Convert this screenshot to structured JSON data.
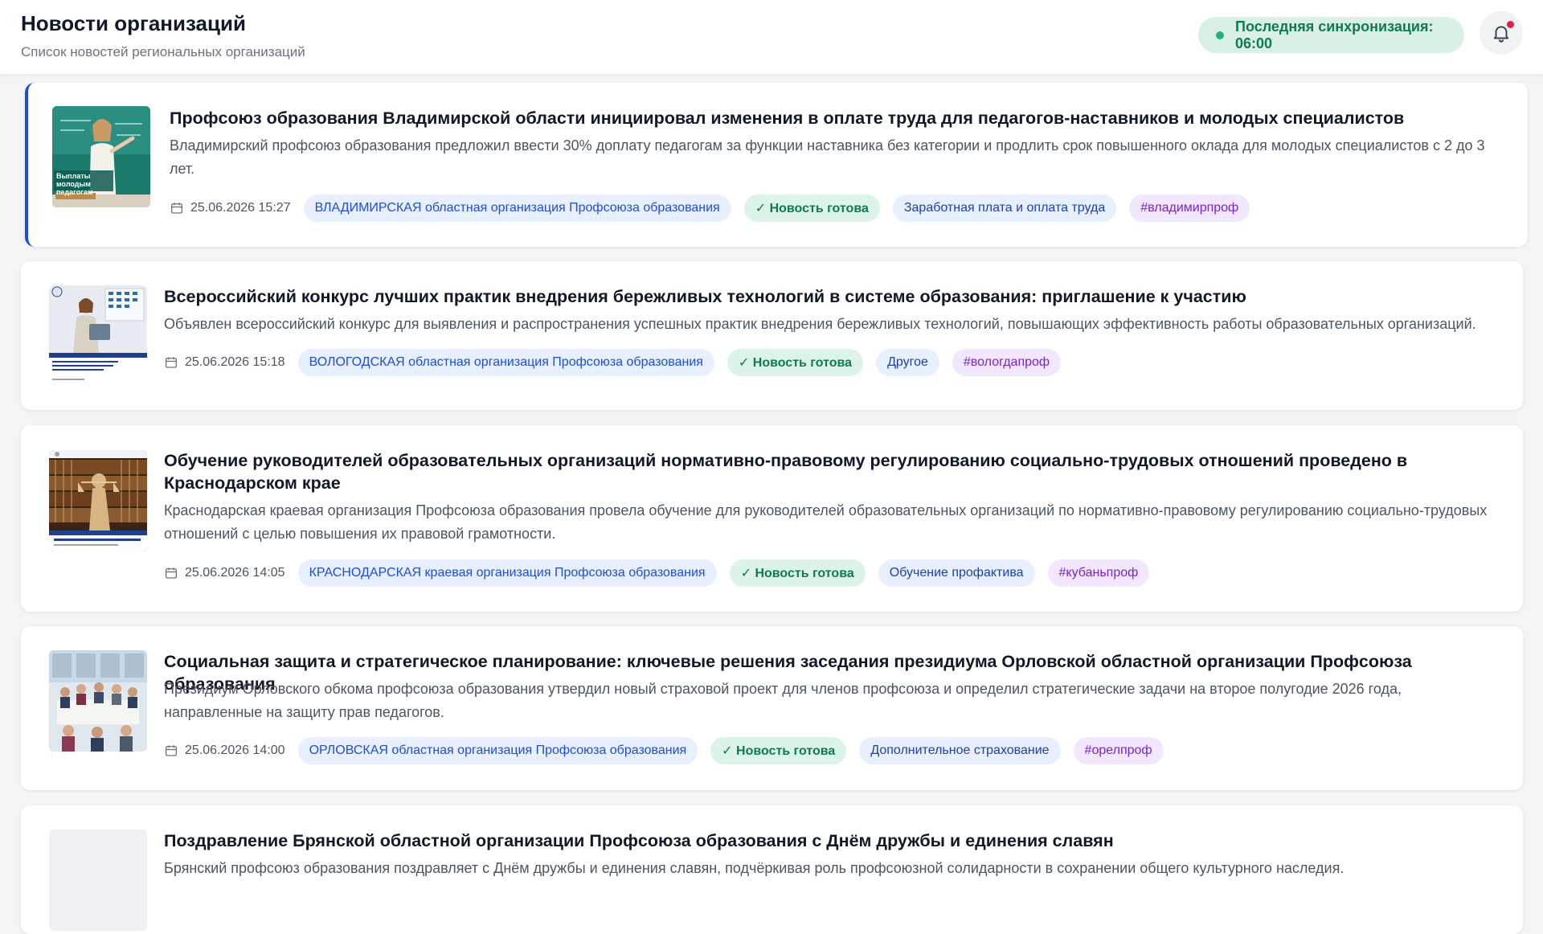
{
  "header": {
    "title": "Новости организаций",
    "subtitle": "Список новостей региональных организаций",
    "sync_label": "Последняя синхронизация: 06:00",
    "bell_icon": "bell-icon",
    "has_notification": true
  },
  "colors": {
    "accent": "#1d4ed8",
    "ready_green": "#0f7a53",
    "hashtag_purple": "#7e22ce",
    "notification_red": "#e11d48"
  },
  "news": [
    {
      "title": "Профсоюз образования Владимирской области инициировал изменения в оплате труда для педагогов-наставников и молодых специалистов",
      "description": "Владимирский профсоюз образования предложил ввести 30% доплату педагогам за функции наставника без категории и продлить срок повышенного оклада для молодых специалистов с 2 до 3 лет.",
      "date": "25.06.2026 15:27",
      "organization": "ВЛАДИМИРСКАЯ областная организация Профсоюза образования",
      "status": "✓ Новость готова",
      "category": "Заработная плата и оплата труда",
      "hashtag": "#владимирпроф",
      "thumb_caption": "Выплаты молодым педагогам"
    },
    {
      "title": "Всероссийский конкурс лучших практик внедрения бережливых технологий в системе образования: приглашение к участию",
      "description": "Объявлен всероссийский конкурс для выявления и распространения успешных практик внедрения бережливых технологий, повышающих эффективность работы образовательных организаций.",
      "date": "25.06.2026 15:18",
      "organization": "ВОЛОГОДСКАЯ областная организация Профсоюза образования",
      "status": "✓ Новость готова",
      "category": "Другое",
      "hashtag": "#вологдапроф"
    },
    {
      "title": "Обучение руководителей образовательных организаций нормативно-правовому регулированию социально-трудовых отношений проведено в Краснодарском крае",
      "description": "Краснодарская краевая организация Профсоюза образования провела обучение для руководителей образовательных организаций по нормативно-правовому регулированию социально-трудовых отношений с целью повышения их правовой грамотности.",
      "date": "25.06.2026 14:05",
      "organization": "КРАСНОДАРСКАЯ краевая организация Профсоюза образования",
      "status": "✓ Новость готова",
      "category": "Обучение профактива",
      "hashtag": "#кубаньпроф"
    },
    {
      "title": "Социальная защита и стратегическое планирование: ключевые решения заседания президиума Орловской областной организации Профсоюза образования",
      "description": "Президиум Орловского обкома профсоюза образования утвердил новый страховой проект для членов профсоюза и определил стратегические задачи на второе полугодие 2026 года, направленные на защиту прав педагогов.",
      "date": "25.06.2026 14:00",
      "organization": "ОРЛОВСКАЯ областная организация Профсоюза образования",
      "status": "✓ Новость готова",
      "category": "Дополнительное страхование",
      "hashtag": "#орелпроф"
    },
    {
      "title": "Поздравление Брянской областной организации Профсоюза образования с Днём дружбы и единения славян",
      "description": "Брянский профсоюз образования поздравляет с Днём дружбы и единения славян, подчёркивая роль профсоюзной солидарности в сохранении общего культурного наследия."
    }
  ]
}
